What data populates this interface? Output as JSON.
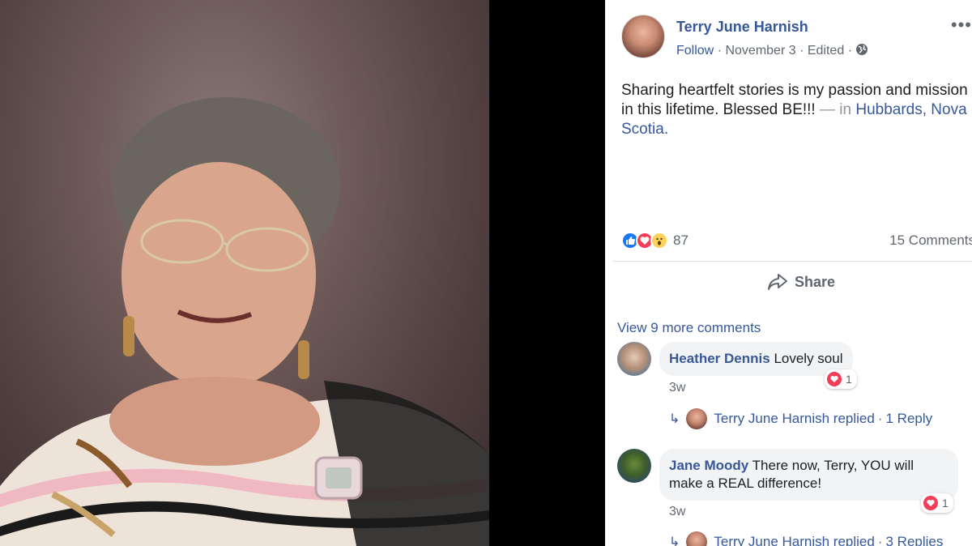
{
  "post": {
    "author": "Terry June Harnish",
    "follow": "Follow",
    "sep1": "·",
    "date": "November 3",
    "sep2": "·",
    "edited": "Edited",
    "sep3": "·",
    "more": "•••",
    "text_main": "Sharing heartfelt stories is my passion and mission in this lifetime. Blessed BE!!!",
    "text_in": " — in ",
    "location_a": "Hubbards",
    "location_sep": ", ",
    "location_b": "Nova Scotia",
    "location_end": ".",
    "reaction_count": "87",
    "comments_count": "15 Comments",
    "share_label": "Share",
    "privacy_icon": "globe-icon"
  },
  "comments": {
    "view_more": "View 9 more comments",
    "items": [
      {
        "name": "Heather Dennis",
        "text": "Lovely soul",
        "reaction_count": "1",
        "time": "3w",
        "reply_author": "Terry June Harnish replied",
        "reply_sep": "·",
        "reply_count": "1 Reply"
      },
      {
        "name": "Jane Moody",
        "text": "There now, Terry, YOU will make a REAL difference!",
        "reaction_count": "1",
        "time": "3w",
        "reply_author": "Terry June Harnish replied",
        "reply_sep": "·",
        "reply_count": "3 Replies"
      }
    ]
  },
  "colors": {
    "link": "#365899",
    "meta": "#616770",
    "like": "#1877f2",
    "love": "#f33e58",
    "wow": "#fcd35a"
  }
}
